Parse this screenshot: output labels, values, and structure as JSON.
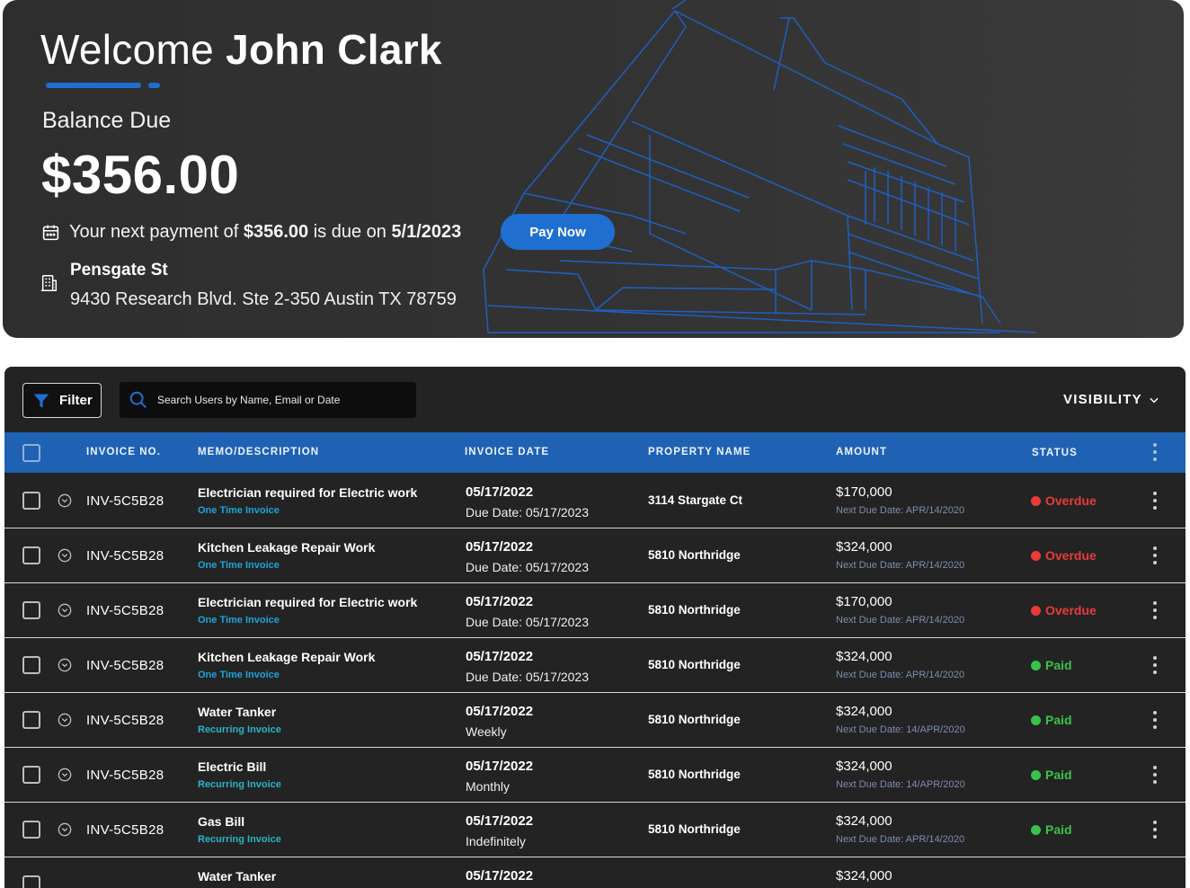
{
  "hero": {
    "welcome_prefix": "Welcome",
    "user_name": "John Clark",
    "balance_label": "Balance Due",
    "balance_amount": "$356.00",
    "next_payment_prefix": "Your next payment of",
    "next_payment_amount": "$356.00",
    "next_payment_mid": "is due on",
    "next_payment_date": "5/1/2023",
    "pay_button": "Pay Now",
    "property_name": "Pensgate St",
    "property_address": "9430 Research Blvd. Ste 2-350 Austin TX 78759"
  },
  "toolbar": {
    "filter_label": "Filter",
    "search_placeholder": "Search Users by Name, Email or Date",
    "visibility_label": "VISIBILITY"
  },
  "table": {
    "headers": {
      "invoice_no": "INVOICE NO.",
      "memo": "MEMO/DESCRIPTION",
      "invoice_date": "INVOICE DATE",
      "property": "PROPERTY NAME",
      "amount": "AMOUNT",
      "status": "STATUS"
    },
    "rows": [
      {
        "invoice_no": "INV-5C5B28",
        "memo": "Electrician required for Electric work",
        "memo_type": "One Time Invoice",
        "date": "05/17/2022",
        "due": "Due Date: 05/17/2023",
        "property": "3114 Stargate Ct",
        "amount": "$170,000",
        "next_due": "Next Due Date: APR/14/2020",
        "status": "Overdue"
      },
      {
        "invoice_no": "INV-5C5B28",
        "memo": "Kitchen Leakage Repair Work",
        "memo_type": "One Time Invoice",
        "date": "05/17/2022",
        "due": "Due Date: 05/17/2023",
        "property": "5810 Northridge",
        "amount": "$324,000",
        "next_due": "Next Due Date: APR/14/2020",
        "status": "Overdue"
      },
      {
        "invoice_no": "INV-5C5B28",
        "memo": "Electrician required for Electric work",
        "memo_type": "One Time Invoice",
        "date": "05/17/2022",
        "due": "Due Date: 05/17/2023",
        "property": "5810 Northridge",
        "amount": "$170,000",
        "next_due": "Next Due Date: APR/14/2020",
        "status": "Overdue"
      },
      {
        "invoice_no": "INV-5C5B28",
        "memo": "Kitchen Leakage Repair Work",
        "memo_type": "One Time Invoice",
        "date": "05/17/2022",
        "due": "Due Date: 05/17/2023",
        "property": "5810 Northridge",
        "amount": "$324,000",
        "next_due": "Next Due Date: APR/14/2020",
        "status": "Paid"
      },
      {
        "invoice_no": "INV-5C5B28",
        "memo": "Water Tanker",
        "memo_type": "Recurring Invoice",
        "date": "05/17/2022",
        "due": "Weekly",
        "property": "5810 Northridge",
        "amount": "$324,000",
        "next_due": "Next Due Date: 14/APR/2020",
        "status": "Paid"
      },
      {
        "invoice_no": "INV-5C5B28",
        "memo": "Electric Bill",
        "memo_type": "Recurring Invoice",
        "date": "05/17/2022",
        "due": "Monthly",
        "property": "5810 Northridge",
        "amount": "$324,000",
        "next_due": "Next Due Date: 14/APR/2020",
        "status": "Paid"
      },
      {
        "invoice_no": "INV-5C5B28",
        "memo": "Gas Bill",
        "memo_type": "Recurring Invoice",
        "date": "05/17/2022",
        "due": "Indefinitely",
        "property": "5810 Northridge",
        "amount": "$324,000",
        "next_due": "Next Due Date: APR/14/2020",
        "status": "Paid"
      },
      {
        "invoice_no": "",
        "memo": "Water Tanker",
        "memo_type": "",
        "date": "05/17/2022",
        "due": "",
        "property": "",
        "amount": "$324,000",
        "next_due": "",
        "status": ""
      }
    ]
  },
  "colors": {
    "accent": "#1f6fd1",
    "header_bg": "#1f62b4",
    "overdue": "#ea3a3a",
    "paid": "#38c24a",
    "link": "#1aa6d9"
  },
  "icons": [
    "calendar-icon",
    "building-icon",
    "filter-icon",
    "search-icon",
    "chevron-down-icon",
    "expand-icon",
    "more-vertical-icon",
    "status-dot-icon"
  ]
}
